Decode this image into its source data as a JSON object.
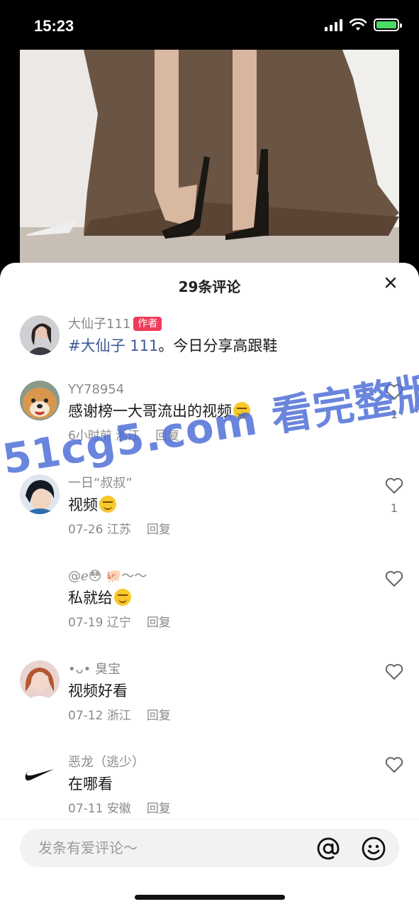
{
  "status_bar": {
    "time": "15:23"
  },
  "comments_panel": {
    "title": "29条评论",
    "comments": [
      {
        "name": "大仙子111",
        "tag": "作者",
        "hashtag": "#大仙子 111",
        "text": "。今日分享高跟鞋"
      },
      {
        "name": "YY78954",
        "text": "感谢榜一大哥流出的视频",
        "time": "6小时前",
        "location": "浙江",
        "reply": "回复",
        "likes": "1"
      },
      {
        "name": "一日“叔叔”",
        "text": "视频",
        "time": "07-26",
        "location": "江苏",
        "reply": "回复",
        "likes": "1"
      },
      {
        "name": "@ℯ😳 🐖～～",
        "text": "私就给",
        "time": "07-19",
        "location": "辽宁",
        "reply": "回复"
      },
      {
        "name": "•ᴗ• 臭宝",
        "text": "视频好看",
        "time": "07-12",
        "location": "浙江",
        "reply": "回复"
      },
      {
        "name": "恶龙（逃少）",
        "text": "在哪看",
        "time": "07-11",
        "location": "安徽",
        "reply": "回复"
      }
    ],
    "input_placeholder": "发条有爱评论～"
  },
  "watermark": "51cg5.com 看完整版",
  "colors": {
    "author_tag": "#f23a5b",
    "hashtag": "#3d5a99",
    "watermark": "#4a6bd6"
  }
}
